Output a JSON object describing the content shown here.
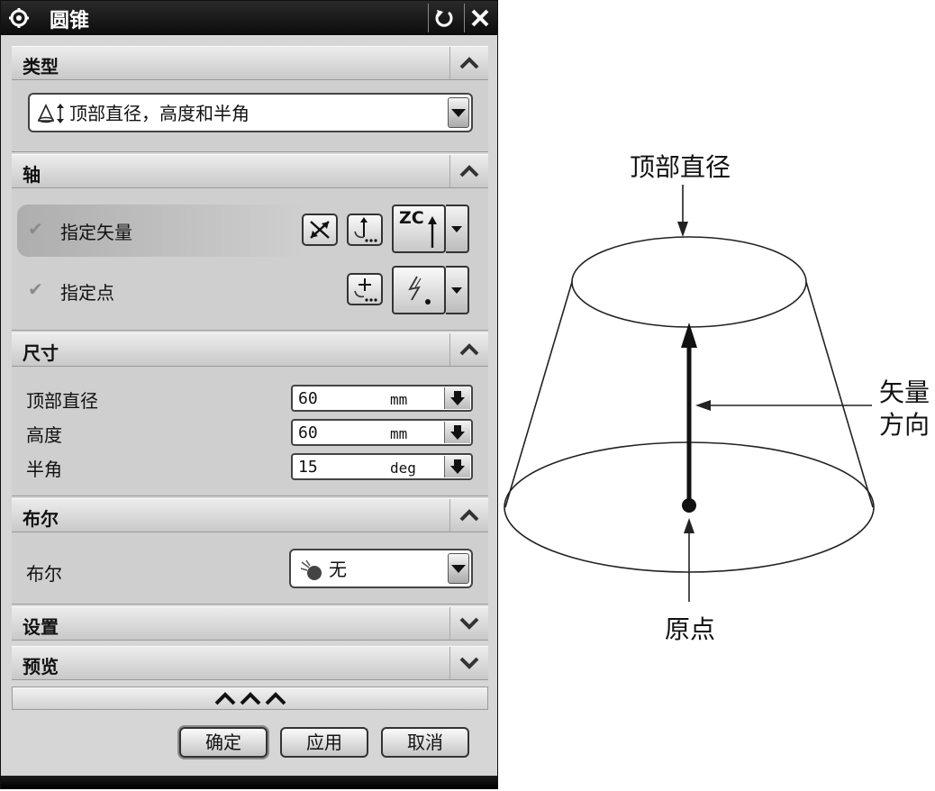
{
  "dialog": {
    "title": "圆锥",
    "sections": {
      "type": {
        "title": "类型",
        "selected": "顶部直径，高度和半角"
      },
      "axis": {
        "title": "轴",
        "vector_label": "指定矢量",
        "point_label": "指定点",
        "vector_option": "ZC"
      },
      "dimensions": {
        "title": "尺寸",
        "fields": [
          {
            "label": "顶部直径",
            "value": "60",
            "unit": "mm"
          },
          {
            "label": "高度",
            "value": "60",
            "unit": "mm"
          },
          {
            "label": "半角",
            "value": "15",
            "unit": "deg"
          }
        ]
      },
      "boolean": {
        "title": "布尔",
        "label": "布尔",
        "selected": "无"
      },
      "settings": {
        "title": "设置"
      },
      "preview": {
        "title": "预览"
      }
    },
    "buttons": {
      "ok": "确定",
      "apply": "应用",
      "cancel": "取消"
    }
  },
  "figure": {
    "top_label": "顶部直径",
    "vector_label_line1": "矢量",
    "vector_label_line2": "方向",
    "origin_label": "原点"
  }
}
